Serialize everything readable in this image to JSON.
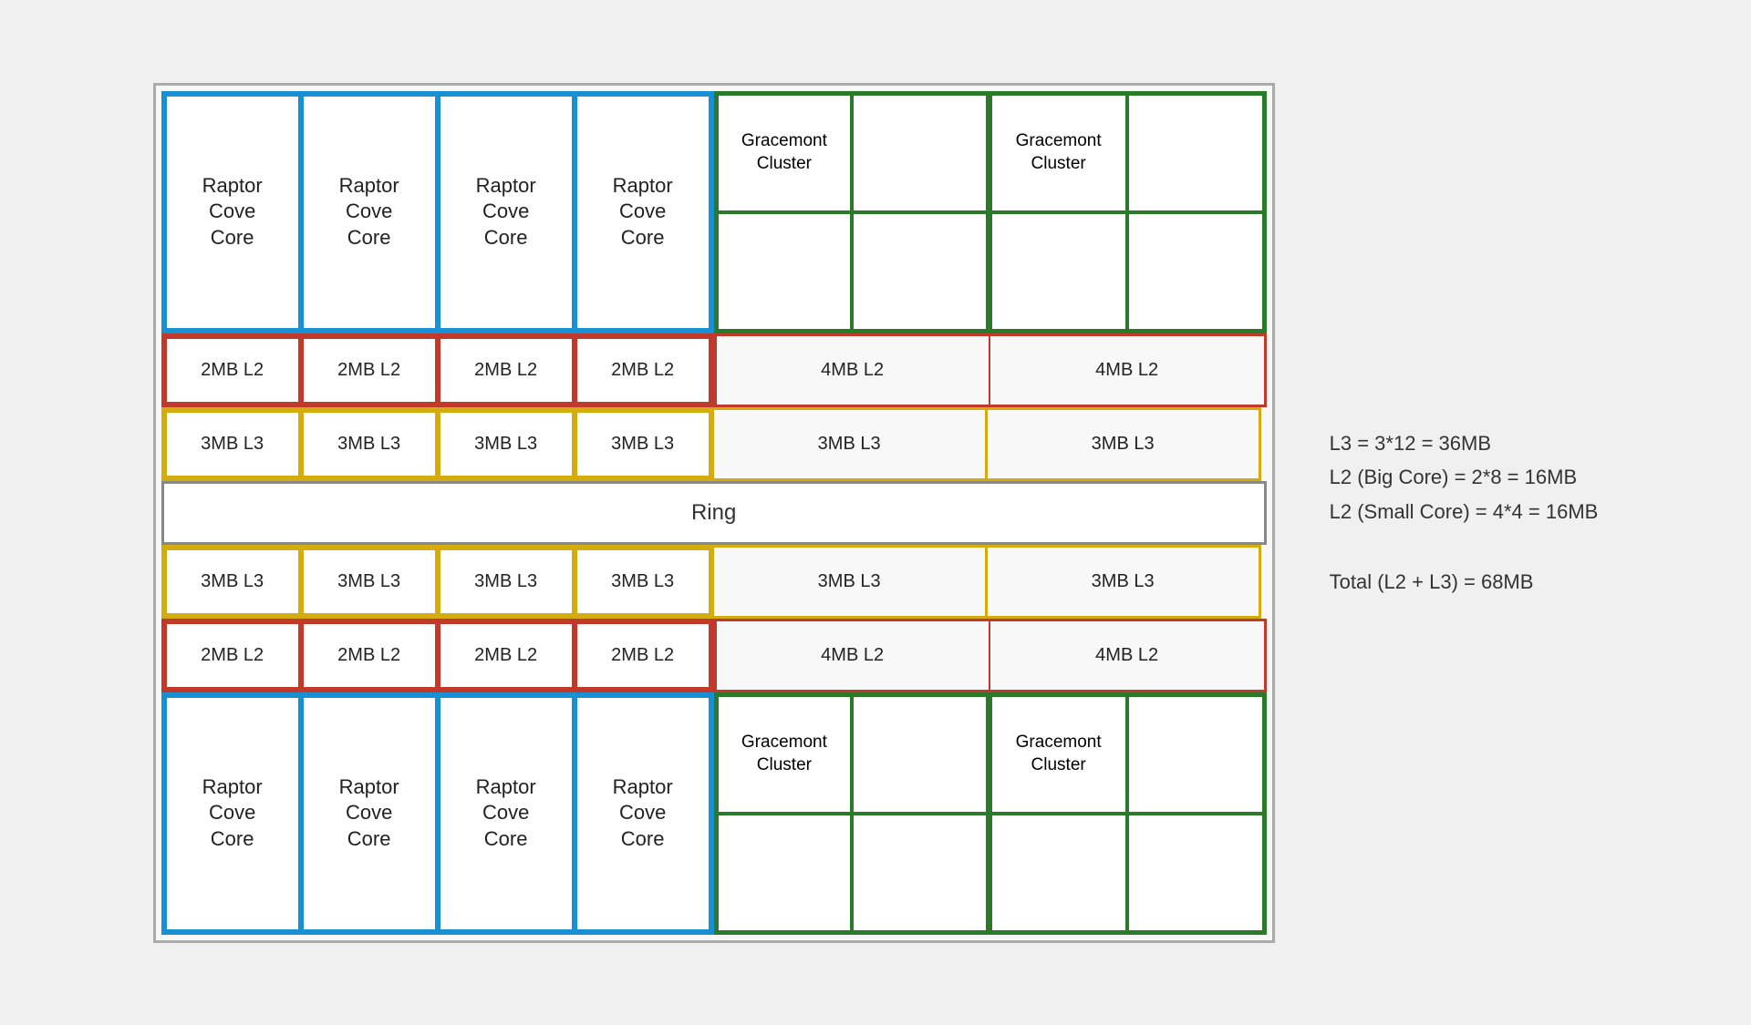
{
  "diagram": {
    "raptor_cores": {
      "top_row": [
        "Raptor\nCove\nCore",
        "Raptor\nCove\nCore",
        "Raptor\nCove\nCore",
        "Raptor\nCove\nCore"
      ],
      "bottom_row": [
        "Raptor\nCove\nCore",
        "Raptor\nCove\nCore",
        "Raptor\nCove\nCore",
        "Raptor\nCove\nCore"
      ]
    },
    "gracemont_clusters": {
      "top": [
        "Gracemont\nCluster",
        "Gracemont\nCluster"
      ],
      "bottom": [
        "Gracemont\nCluster",
        "Gracemont\nCluster"
      ]
    },
    "l2_big": "2MB L2",
    "l2_small": "4MB L2",
    "l3": "3MB L3",
    "ring": "Ring"
  },
  "legend": {
    "l3_formula": "L3 = 3*12 = 36MB",
    "l2_big_formula": "L2 (Big Core) = 2*8 = 16MB",
    "l2_small_formula": "L2 (Small Core) = 4*4 = 16MB",
    "total_formula": "Total (L2 + L3) = 68MB"
  }
}
